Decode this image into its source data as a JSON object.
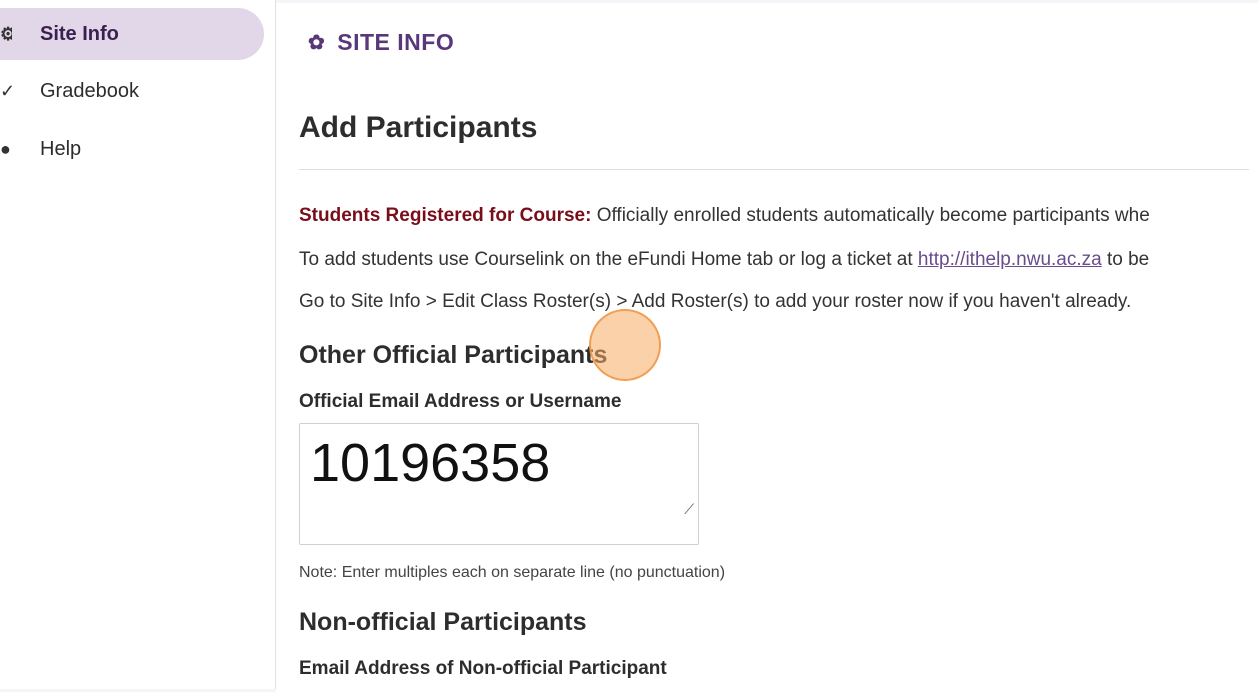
{
  "sidebar": {
    "items": [
      {
        "label": "Site Info",
        "icon": "gear-icon",
        "glyph": "⚙"
      },
      {
        "label": "Gradebook",
        "icon": "gradebook-icon",
        "glyph": "✓"
      },
      {
        "label": "Help",
        "icon": "help-icon",
        "glyph": "●"
      }
    ]
  },
  "tool": {
    "title": "SITE INFO",
    "icon": "gear-icon",
    "glyph": "✿"
  },
  "page": {
    "title": "Add Participants",
    "registered_label": "Students Registered for Course:",
    "registered_text": " Officially enrolled students automatically become participants whe",
    "line2_prefix": "To add students use Courselink on the eFundi Home tab or log a ticket at ",
    "line2_link": "http://ithelp.nwu.ac.za",
    "line2_suffix": " to be",
    "line3": "Go to Site Info > Edit Class Roster(s) > Add Roster(s) to add your roster now if you haven't already."
  },
  "official": {
    "heading": "Other Official Participants",
    "field_label": "Official Email Address or Username",
    "value": "10196358",
    "note": "Note: Enter multiples each on separate line (no punctuation)"
  },
  "nonofficial": {
    "heading": "Non-official Participants",
    "field_label": "Email Address of Non-official Participant"
  },
  "colors": {
    "accent": "#59387a",
    "active_nav_bg": "#e2d7e9",
    "registered_label": "#7a0d1a",
    "click_marker": "#f7ab63"
  }
}
